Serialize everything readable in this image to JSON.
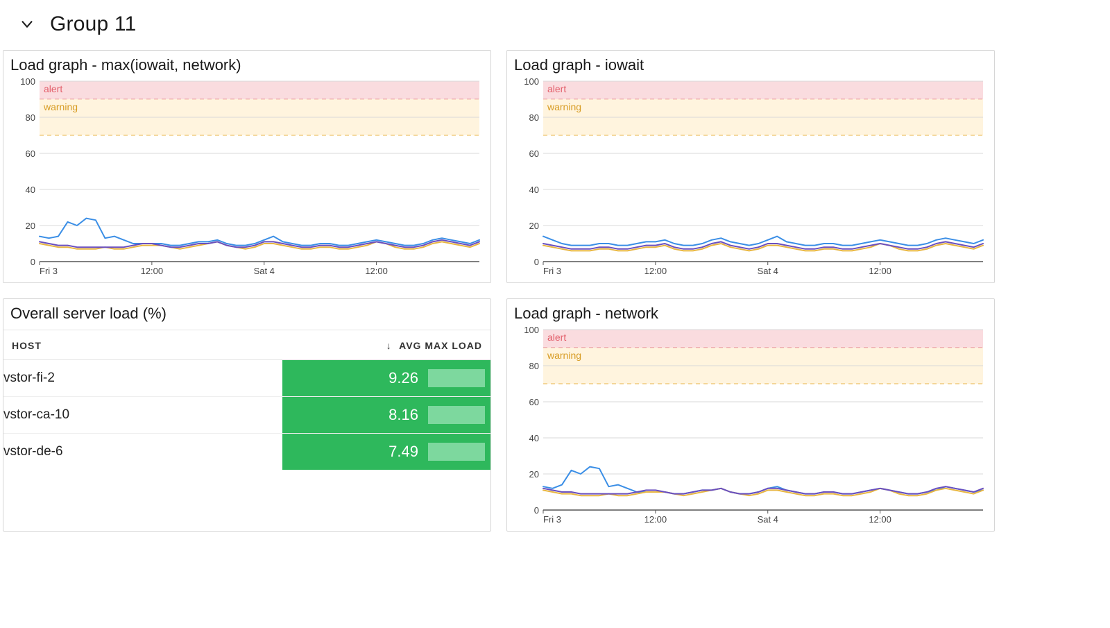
{
  "group": {
    "title": "Group 11"
  },
  "panels": {
    "max": {
      "title": "Load graph - max(iowait, network)"
    },
    "iowait": {
      "title": "Load graph - iowait"
    },
    "table": {
      "title": "Overall server load (%)",
      "header_host": "HOST",
      "header_value": "AVG MAX LOAD",
      "rows": [
        {
          "host": "vstor-fi-2",
          "value": "9.26"
        },
        {
          "host": "vstor-ca-10",
          "value": "8.16"
        },
        {
          "host": "vstor-de-6",
          "value": "7.49"
        }
      ]
    },
    "network": {
      "title": "Load graph - network"
    }
  },
  "thresholds": {
    "alert": {
      "label": "alert",
      "min": 90,
      "max": 100,
      "color": "#f7c5c9",
      "line": "#e07a86",
      "text": "#e25e6a"
    },
    "warning": {
      "label": "warning",
      "min": 70,
      "max": 90,
      "color": "#ffecc8",
      "line": "#e8b64a",
      "text": "#d79b22"
    }
  },
  "axes": {
    "y_ticks": [
      0,
      20,
      40,
      60,
      80,
      100
    ],
    "x_ticks": [
      {
        "i": 0,
        "label": "Fri 3"
      },
      {
        "i": 12,
        "label": "12:00"
      },
      {
        "i": 24,
        "label": "Sat 4"
      },
      {
        "i": 36,
        "label": "12:00"
      }
    ],
    "ylim": [
      0,
      100
    ]
  },
  "series_colors": {
    "blue": "#3a8ee6",
    "yellow": "#e8b642",
    "green": "#55b46d",
    "purple": "#6a4fbf"
  },
  "chart_data": [
    {
      "type": "line",
      "title": "Load graph - max(iowait, network)",
      "xlabel": "",
      "ylabel": "",
      "ylim": [
        0,
        100
      ],
      "thresholds": [
        {
          "label": "alert",
          "from": 90,
          "to": 100
        },
        {
          "label": "warning",
          "from": 70,
          "to": 90
        }
      ],
      "x": [
        0,
        1,
        2,
        3,
        4,
        5,
        6,
        7,
        8,
        9,
        10,
        11,
        12,
        13,
        14,
        15,
        16,
        17,
        18,
        19,
        20,
        21,
        22,
        23,
        24,
        25,
        26,
        27,
        28,
        29,
        30,
        31,
        32,
        33,
        34,
        35,
        36,
        37,
        38,
        39,
        40,
        41,
        42,
        43,
        44,
        45,
        46,
        47
      ],
      "x_tick_labels": {
        "0": "Fri 3",
        "12": "12:00",
        "24": "Sat 4",
        "36": "12:00"
      },
      "series": [
        {
          "name": "vstor-fi-2",
          "color": "blue",
          "values": [
            14,
            13,
            14,
            22,
            20,
            24,
            23,
            13,
            14,
            12,
            10,
            10,
            10,
            10,
            9,
            9,
            10,
            11,
            11,
            12,
            10,
            9,
            9,
            10,
            12,
            14,
            11,
            10,
            9,
            9,
            10,
            10,
            9,
            9,
            10,
            11,
            12,
            11,
            10,
            9,
            9,
            10,
            12,
            13,
            12,
            11,
            10,
            12
          ]
        },
        {
          "name": "vstor-ca-10",
          "color": "yellow",
          "values": [
            10,
            9,
            8,
            8,
            7,
            7,
            7,
            8,
            7,
            7,
            8,
            9,
            9,
            9,
            8,
            7,
            8,
            9,
            10,
            11,
            9,
            8,
            7,
            8,
            10,
            10,
            9,
            8,
            7,
            7,
            8,
            8,
            7,
            7,
            8,
            9,
            11,
            10,
            8,
            7,
            7,
            8,
            10,
            11,
            10,
            9,
            8,
            10
          ]
        },
        {
          "name": "vstor-de-6",
          "color": "purple",
          "values": [
            11,
            10,
            9,
            9,
            8,
            8,
            8,
            8,
            8,
            8,
            9,
            10,
            10,
            9,
            8,
            8,
            9,
            10,
            10,
            11,
            9,
            8,
            8,
            9,
            11,
            11,
            10,
            9,
            8,
            8,
            9,
            9,
            8,
            8,
            9,
            10,
            11,
            10,
            9,
            8,
            8,
            9,
            11,
            12,
            11,
            10,
            9,
            11
          ]
        }
      ]
    },
    {
      "type": "line",
      "title": "Load graph - iowait",
      "xlabel": "",
      "ylabel": "",
      "ylim": [
        0,
        100
      ],
      "thresholds": [
        {
          "label": "alert",
          "from": 90,
          "to": 100
        },
        {
          "label": "warning",
          "from": 70,
          "to": 90
        }
      ],
      "x": [
        0,
        1,
        2,
        3,
        4,
        5,
        6,
        7,
        8,
        9,
        10,
        11,
        12,
        13,
        14,
        15,
        16,
        17,
        18,
        19,
        20,
        21,
        22,
        23,
        24,
        25,
        26,
        27,
        28,
        29,
        30,
        31,
        32,
        33,
        34,
        35,
        36,
        37,
        38,
        39,
        40,
        41,
        42,
        43,
        44,
        45,
        46,
        47
      ],
      "x_tick_labels": {
        "0": "Fri 3",
        "12": "12:00",
        "24": "Sat 4",
        "36": "12:00"
      },
      "series": [
        {
          "name": "vstor-fi-2",
          "color": "blue",
          "values": [
            14,
            12,
            10,
            9,
            9,
            9,
            10,
            10,
            9,
            9,
            10,
            11,
            11,
            12,
            10,
            9,
            9,
            10,
            12,
            13,
            11,
            10,
            9,
            10,
            12,
            14,
            11,
            10,
            9,
            9,
            10,
            10,
            9,
            9,
            10,
            11,
            12,
            11,
            10,
            9,
            9,
            10,
            12,
            13,
            12,
            11,
            10,
            12
          ]
        },
        {
          "name": "vstor-ca-10",
          "color": "yellow",
          "values": [
            9,
            8,
            7,
            6,
            6,
            6,
            7,
            7,
            6,
            6,
            7,
            8,
            8,
            9,
            7,
            6,
            6,
            7,
            9,
            10,
            8,
            7,
            6,
            7,
            9,
            9,
            8,
            7,
            6,
            6,
            7,
            7,
            6,
            6,
            7,
            8,
            10,
            9,
            7,
            6,
            6,
            7,
            9,
            10,
            9,
            8,
            7,
            9
          ]
        },
        {
          "name": "vstor-de-6",
          "color": "purple",
          "values": [
            10,
            9,
            8,
            7,
            7,
            7,
            8,
            8,
            7,
            7,
            8,
            9,
            9,
            10,
            8,
            7,
            7,
            8,
            10,
            11,
            9,
            8,
            7,
            8,
            10,
            10,
            9,
            8,
            7,
            7,
            8,
            8,
            7,
            7,
            8,
            9,
            10,
            9,
            8,
            7,
            7,
            8,
            10,
            11,
            10,
            9,
            8,
            10
          ]
        }
      ]
    },
    {
      "type": "table",
      "title": "Overall server load (%)",
      "columns": [
        "HOST",
        "AVG MAX LOAD"
      ],
      "sort": {
        "column": "AVG MAX LOAD",
        "dir": "desc"
      },
      "rows": [
        {
          "HOST": "vstor-fi-2",
          "AVG MAX LOAD": 9.26
        },
        {
          "HOST": "vstor-ca-10",
          "AVG MAX LOAD": 8.16
        },
        {
          "HOST": "vstor-de-6",
          "AVG MAX LOAD": 7.49
        }
      ]
    },
    {
      "type": "line",
      "title": "Load graph - network",
      "xlabel": "",
      "ylabel": "",
      "ylim": [
        0,
        100
      ],
      "thresholds": [
        {
          "label": "alert",
          "from": 90,
          "to": 100
        },
        {
          "label": "warning",
          "from": 70,
          "to": 90
        }
      ],
      "x": [
        0,
        1,
        2,
        3,
        4,
        5,
        6,
        7,
        8,
        9,
        10,
        11,
        12,
        13,
        14,
        15,
        16,
        17,
        18,
        19,
        20,
        21,
        22,
        23,
        24,
        25,
        26,
        27,
        28,
        29,
        30,
        31,
        32,
        33,
        34,
        35,
        36,
        37,
        38,
        39,
        40,
        41,
        42,
        43,
        44,
        45,
        46,
        47
      ],
      "x_tick_labels": {
        "0": "Fri 3",
        "12": "12:00",
        "24": "Sat 4",
        "36": "12:00"
      },
      "series": [
        {
          "name": "vstor-fi-2",
          "color": "blue",
          "values": [
            13,
            12,
            14,
            22,
            20,
            24,
            23,
            13,
            14,
            12,
            10,
            10,
            10,
            10,
            9,
            9,
            10,
            11,
            11,
            12,
            10,
            9,
            9,
            10,
            12,
            13,
            11,
            10,
            9,
            9,
            10,
            10,
            9,
            9,
            10,
            11,
            12,
            11,
            10,
            9,
            9,
            10,
            11,
            13,
            12,
            11,
            10,
            11
          ]
        },
        {
          "name": "vstor-ca-10",
          "color": "yellow",
          "values": [
            11,
            10,
            9,
            9,
            8,
            8,
            8,
            9,
            8,
            8,
            9,
            10,
            10,
            10,
            9,
            8,
            9,
            10,
            11,
            12,
            10,
            9,
            8,
            9,
            11,
            11,
            10,
            9,
            8,
            8,
            9,
            9,
            8,
            8,
            9,
            10,
            12,
            11,
            9,
            8,
            8,
            9,
            11,
            12,
            11,
            10,
            9,
            11
          ]
        },
        {
          "name": "vstor-de-6",
          "color": "purple",
          "values": [
            12,
            11,
            10,
            10,
            9,
            9,
            9,
            9,
            9,
            9,
            10,
            11,
            11,
            10,
            9,
            9,
            10,
            11,
            11,
            12,
            10,
            9,
            9,
            10,
            12,
            12,
            11,
            10,
            9,
            9,
            10,
            10,
            9,
            9,
            10,
            11,
            12,
            11,
            10,
            9,
            9,
            10,
            12,
            13,
            12,
            11,
            10,
            12
          ]
        }
      ]
    }
  ]
}
